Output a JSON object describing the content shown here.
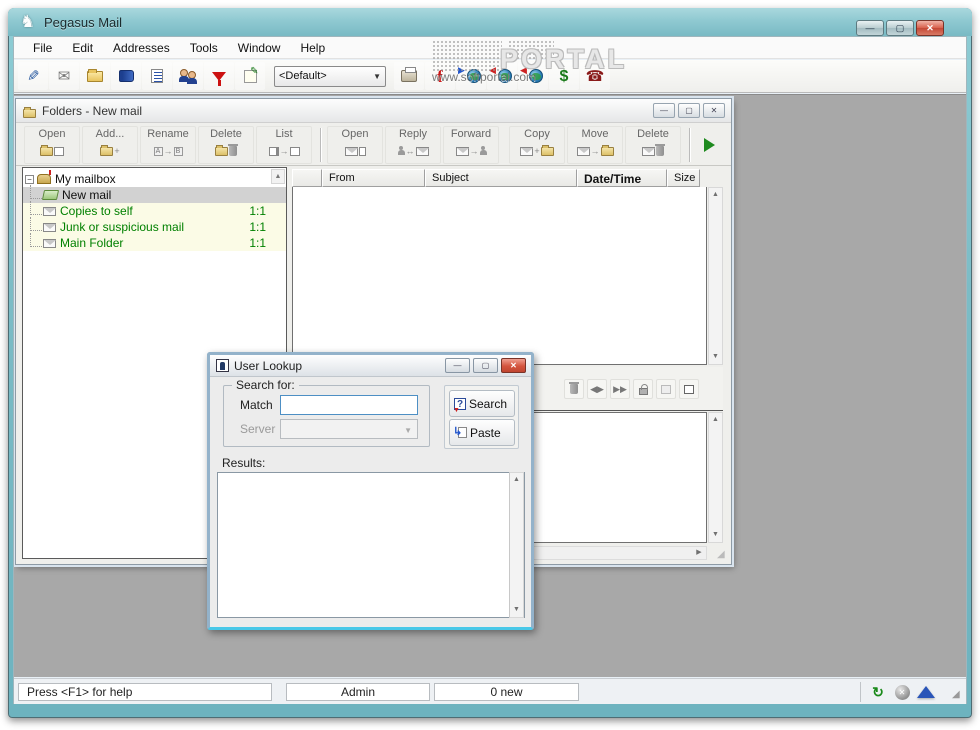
{
  "window": {
    "title": "Pegasus Mail"
  },
  "window_controls": {
    "minimize": "—",
    "maximize": "▢",
    "close": "✕"
  },
  "menu": {
    "items": [
      "File",
      "Edit",
      "Addresses",
      "Tools",
      "Window",
      "Help"
    ]
  },
  "main_toolbar": {
    "profile_selector": "<Default>"
  },
  "watermark": {
    "brand": "PORTAL",
    "url": "www.softportal.com"
  },
  "folders_window": {
    "title": "Folders - New mail",
    "toolbar": {
      "buttons": [
        {
          "label": "Open"
        },
        {
          "label": "Add..."
        },
        {
          "label": "Rename"
        },
        {
          "label": "Delete"
        },
        {
          "label": "List"
        },
        {
          "label": "Open"
        },
        {
          "label": "Reply"
        },
        {
          "label": "Forward"
        },
        {
          "label": "Copy"
        },
        {
          "label": "Move"
        },
        {
          "label": "Delete"
        }
      ]
    },
    "tree": {
      "root": "My mailbox",
      "items": [
        {
          "label": "New mail",
          "badge": "",
          "state": "selected"
        },
        {
          "label": "Copies to self",
          "badge": "1:1",
          "state": "normal"
        },
        {
          "label": "Junk or suspicious mail",
          "badge": "1:1",
          "state": "normal"
        },
        {
          "label": "Main Folder",
          "badge": "1:1",
          "state": "normal"
        }
      ]
    },
    "list": {
      "headers": [
        "",
        "From",
        "Subject",
        "Date/Time",
        "Size"
      ],
      "rows": []
    }
  },
  "dialog": {
    "title": "User Lookup",
    "group_label": "Search for:",
    "match_label": "Match",
    "match_value": "",
    "server_label": "Server",
    "server_value": "",
    "search_button": "Search",
    "paste_button": "Paste",
    "results_label": "Results:"
  },
  "statusbar": {
    "help": "Press <F1> for help",
    "user": "Admin",
    "new_count": "0 new"
  },
  "colors": {
    "titlebar_teal": "#7fbfc9",
    "mdi_gray": "#a8a8a8",
    "folder_green_text": "#008000",
    "close_red": "#d4543e",
    "dialog_border_blue": "#93b2ca"
  },
  "icons": {
    "pegasus": "♞",
    "compose": "✎",
    "read_mail": "✉",
    "phone": "☎",
    "dollar": "$",
    "font_f": "f",
    "up": "▲",
    "down": "▼",
    "left": "◀",
    "right": "▶",
    "double_right": "▶▶",
    "left_right": "◀▶",
    "combo_arrow": "▼",
    "minus": "−",
    "plus": "+",
    "arrow": "→",
    "both": "↔",
    "min_glyph": "—",
    "max_glyph": "▢",
    "close_glyph": "✕",
    "grip": "◢",
    "refresh": "↻",
    "x": "✕"
  }
}
